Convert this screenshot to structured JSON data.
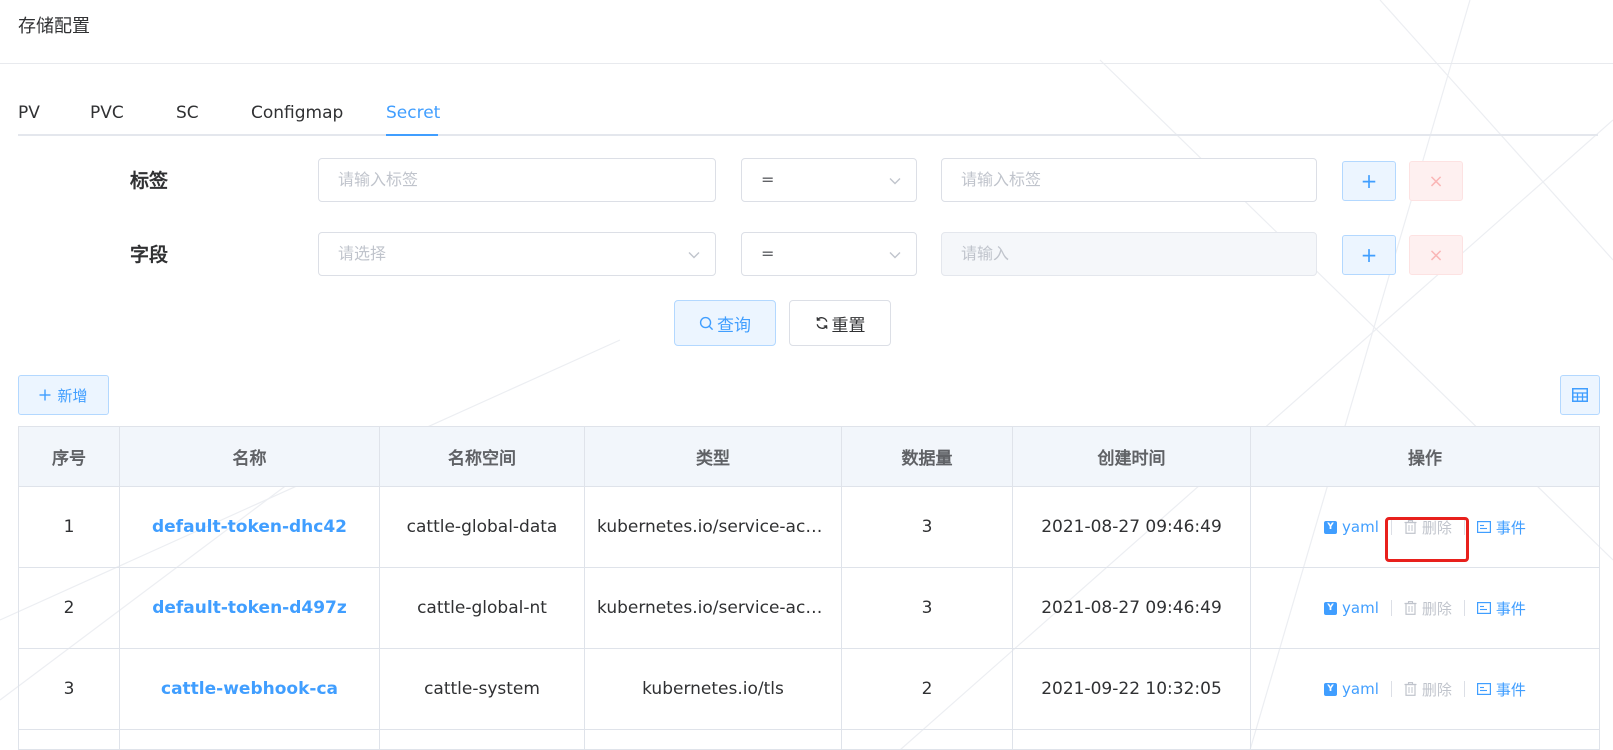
{
  "header": {
    "title": "存储配置"
  },
  "tabs": [
    {
      "label": "PV",
      "active": false
    },
    {
      "label": "PVC",
      "active": false
    },
    {
      "label": "SC",
      "active": false
    },
    {
      "label": "Configmap",
      "active": false
    },
    {
      "label": "Secret",
      "active": true
    }
  ],
  "filters": {
    "label_row": {
      "label": "标签",
      "key_placeholder": "请输入标签",
      "operator": "=",
      "value_placeholder": "请输入标签"
    },
    "field_row": {
      "label": "字段",
      "key_placeholder": "请选择",
      "operator": "=",
      "value_placeholder": "请输入"
    },
    "add_symbol": "+",
    "remove_symbol": "×"
  },
  "actions": {
    "query_label": "查询",
    "reset_label": "重置",
    "add_label": "新增"
  },
  "table": {
    "columns": [
      "序号",
      "名称",
      "名称空间",
      "类型",
      "数据量",
      "创建时间",
      "操作"
    ],
    "rows": [
      {
        "index": "1",
        "name": "default-token-dhc42",
        "namespace": "cattle-global-data",
        "type": "kubernetes.io/service-account-token",
        "count": "3",
        "created": "2021-08-27 09:46:49"
      },
      {
        "index": "2",
        "name": "default-token-d497z",
        "namespace": "cattle-global-nt",
        "type": "kubernetes.io/service-account-token",
        "count": "3",
        "created": "2021-08-27 09:46:49"
      },
      {
        "index": "3",
        "name": "cattle-webhook-ca",
        "namespace": "cattle-system",
        "type": "kubernetes.io/tls",
        "count": "2",
        "created": "2021-09-22 10:32:05"
      }
    ],
    "ops": {
      "yaml_badge": "Y",
      "yaml": "yaml",
      "delete": "删除",
      "event": "事件"
    }
  },
  "colors": {
    "primary": "#409eff",
    "highlight": "#e8201c"
  }
}
